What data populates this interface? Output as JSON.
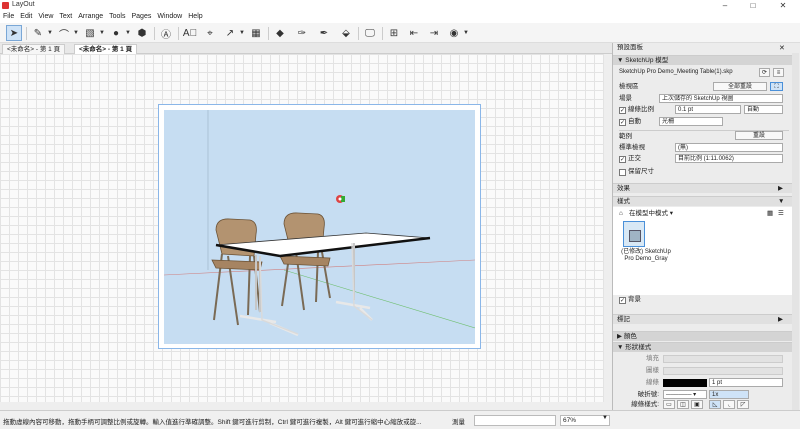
{
  "window": {
    "title": "LayOut",
    "minimize": "–",
    "maximize": "□",
    "close": "✕"
  },
  "menu": [
    "File",
    "Edit",
    "View",
    "Text",
    "Arrange",
    "Tools",
    "Pages",
    "Window",
    "Help"
  ],
  "tabs": [
    {
      "label": "<未命名> - 第 1 頁",
      "active": false
    },
    {
      "label": "<未命名> - 第 1 頁",
      "active": true
    }
  ],
  "status": {
    "hint": "拖動虛線內容可移動，拖動手柄可調整比例或旋轉。輸入值進行準確調整。Shift 鍵可進行剪制，Ctrl 鍵可進行複製，Alt 鍵可進行縮中心縮放或旋...",
    "measure_label": "測量",
    "zoom": "67%"
  },
  "panel": {
    "title": "預設面板",
    "sketchup_model": {
      "header": "SketchUp 模型",
      "file": "SketchUp Pro Demo_Meeting Table(1).skp",
      "view_label": "檢視區",
      "reset_all": "全部重設",
      "scene_label": "場景",
      "scene_value": "上次儲存的 SketchUp 視圖",
      "line_scale_label": "線條比例",
      "line_scale_value": "0.1 pt",
      "line_scale_mode": "自動",
      "auto_label": "自動",
      "render_mode": "光柵",
      "camera_label": "範例",
      "reset": "重設",
      "standard_view_label": "標準檢視",
      "standard_view_value": "(無)",
      "ortho_label": "正交",
      "ortho_value": "目前比例 (1:11.0062)",
      "preserve_scale_label": "保留尺寸",
      "effects_label": "效果",
      "styles_label": "樣式",
      "in_model_label": "在模型中模式 ▾",
      "style_name": "(已修改) SketchUp Pro Demo_Gray",
      "background_label": "背景",
      "tags_label": "標記"
    },
    "colors_header": "顏色",
    "shape_style": {
      "header": "形狀樣式",
      "fill_label": "填充",
      "pattern_label": "圖樣",
      "stroke_label": "線條",
      "stroke_value": "1 pt",
      "dash_label": "破折號:",
      "dash_value": "1x",
      "line_style_label": "線條樣式:",
      "start_arrow_label": "開始箭頭:",
      "start_arrow_value": "2 pt"
    }
  },
  "colors": {
    "accent": "#4a90d9",
    "viewport_bg": "#c6ddf2",
    "stroke_swatch": "#000000"
  }
}
